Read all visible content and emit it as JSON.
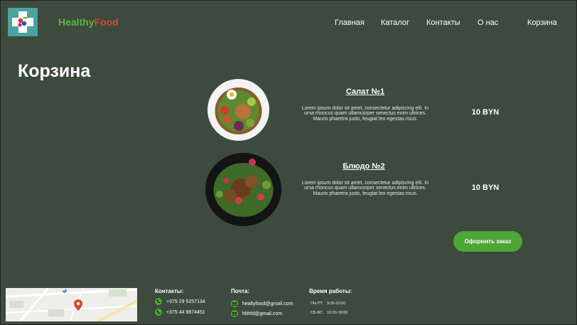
{
  "brand": {
    "part1": "Healthy",
    "part2": "Food"
  },
  "nav": {
    "home": "Главная",
    "catalog": "Каталог",
    "contacts": "Контакты",
    "about": "О нас",
    "cart": "Корзина"
  },
  "page": {
    "title": "Корзина"
  },
  "cart": {
    "items": [
      {
        "name": "Салат №1",
        "description": "Lorem ipsum dolor sit amet, consectetur adipiscing elit. In urna rhoncus quam ullamcorper senectus enim ultrices. Mauris pharetra justo, feugiat leo egestas risus.",
        "price": "10 BYN"
      },
      {
        "name": "Блюдо №2",
        "description": "Lorem ipsum dolor sit amet, consectetur adipiscing elit. In urna rhoncus quam ullamcorper senectus enim ultrices. Mauris pharetra justo, feugiat leo egestas risus.",
        "price": "10 BYN"
      }
    ],
    "order_button": "Оформить заказ"
  },
  "footer": {
    "contacts_title": "Контакты:",
    "phone1": "+375 29 5257134",
    "phone2": "+375 44 9874451",
    "mail_title": "Почта:",
    "email1": "healtyfood@gmail.com",
    "email2": "hlthfd@gmail.com",
    "hours_title": "Время работы:",
    "hours1_days": "ПН-ПТ",
    "hours1_time": "9:00-20:00",
    "hours2_days": "СБ-ВС",
    "hours2_time": "10:00-19:00"
  },
  "colors": {
    "background": "#3d4b3e",
    "accent": "#4ea636",
    "brand_green": "#57b83a",
    "brand_red": "#e0452c",
    "logo_bg": "#4aa3a0"
  },
  "icons": [
    "logo-cross-icon",
    "phone-icon",
    "mail-icon",
    "map-pin-icon"
  ]
}
